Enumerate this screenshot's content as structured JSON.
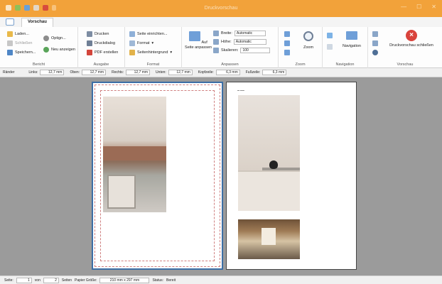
{
  "window": {
    "title": "Druckvorschau"
  },
  "tabs": {
    "active": "Vorschau"
  },
  "ribbon": {
    "bericht": {
      "label": "Bericht",
      "laden": "Laden...",
      "schliessen": "Schließen",
      "speichern": "Speichern...",
      "optionen": "Optign...",
      "neu_anzeigen": "Neu anzeigen"
    },
    "ausgabe": {
      "label": "Ausgabe",
      "drucken": "Drucken",
      "druckdialog": "Druckdialog",
      "pdf": "PDF erstellen"
    },
    "format": {
      "label": "Format",
      "seite_einrichten": "Seite einrichten...",
      "format": "Format",
      "seitenhintergrund": "Seitenhintergrund"
    },
    "anpassen": {
      "label": "Anpassen",
      "auf_seite": "Auf Seite anpassen",
      "breite_label": "Breite:",
      "breite_value": "Automatic",
      "hoehe_label": "Höhe:",
      "hoehe_value": "Automatic",
      "skalieren_label": "Skalieren:",
      "skalieren_value": "100"
    },
    "zoom": {
      "label": "Zoom",
      "zoom": "Zoom"
    },
    "navigation": {
      "label": "Navigation",
      "navigation": "Navigation"
    },
    "vorschau": {
      "label": "Vorschau",
      "close": "Druckvorschau schließen"
    }
  },
  "margins": {
    "title": "Ränder",
    "links_label": "Links:",
    "links": "12,7 mm",
    "oben_label": "Oben:",
    "oben": "12,7 mm",
    "rechts_label": "Rechts:",
    "rechts": "12,7 mm",
    "unten_label": "Unten:",
    "unten": "12,7 mm",
    "kopf_label": "Kopfzeile:",
    "kopf": "6,3 mm",
    "fuss_label": "Fußzeile:",
    "fuss": "6,3 mm"
  },
  "status": {
    "seite_label": "Seite:",
    "seite": "1",
    "von_label": "von",
    "von": "2",
    "seiten_label": "Seiten",
    "papier_label": "Papier Größe:",
    "papier": "210 mm x 297 mm",
    "status_label": "Status:",
    "status": "Bereit"
  },
  "colors": {
    "accent": "#f2a23a",
    "page_border": "#3d6fa6",
    "margin_guide": "#d08080"
  }
}
